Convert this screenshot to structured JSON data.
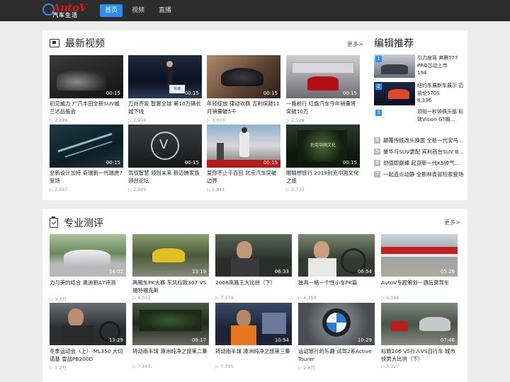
{
  "logo": {
    "text": "AutoV",
    "sub": "汽车生活"
  },
  "nav": [
    "首页",
    "视频",
    "直播"
  ],
  "latest": {
    "title": "最新视频",
    "more": "更多>",
    "items": [
      {
        "title": "初见威力 广汽丰田全新SUV威兰达品鉴会",
        "views": "▷ 2,886",
        "dur": "00:15"
      },
      {
        "title": "万尚齐发 智惠全球 第10万辆长城下线",
        "views": "▷ 2,946",
        "dur": "00:15"
      },
      {
        "title": "年轻绽放 律动欢跳 吉利缤越11月销量破5千",
        "views": "▷ 3,003",
        "dur": "00:15"
      },
      {
        "title": "一路前行 红旗汽车今年销量将突破10万",
        "views": "▷ 2,529",
        "dur": "00:15"
      },
      {
        "title": "全新设计加持 奇瑞新一代瑞虎7登场",
        "views": "▷ 2,947",
        "dur": "00:15"
      },
      {
        "title": "驾驭智慧 领创未来 新迈腾家族领创论坛",
        "views": "▷ 2,909",
        "dur": "00:15"
      },
      {
        "title": "爱你不止千百回 北京汽车突破边界",
        "views": "▷ 2,811",
        "dur": "00:15"
      },
      {
        "title": "眼睛想旅行 2019别克中国文化之旅",
        "views": "▷ 2,733",
        "dur": "00:15"
      }
    ]
  },
  "editor": {
    "title": "编辑推荐",
    "featured": [
      {
        "num": "1",
        "text": "引力座驾 奔腾T77 PRO芯动上市",
        "views": "194"
      },
      {
        "num": "2",
        "text": "纽约车展新车展示 迈凯伦570S",
        "views": "6,336"
      },
      {
        "num": "3",
        "text": "领衔一秒钟俱乐部 标致Vision GT概…",
        "views": ""
      }
    ],
    "ranked": [
      {
        "num": "4",
        "text": "颠覆传统改头换面 全新一代宝马…"
      },
      {
        "num": "5",
        "text": "豪华与SUV更配 宾利首台SUV B…"
      },
      {
        "num": "6",
        "text": "劲值即巅峰 起亚新一代K5帅气…"
      },
      {
        "num": "7",
        "text": "一起造点动静 全新林肯冒险家登场"
      }
    ]
  },
  "review": {
    "title": "专业测评",
    "more": "更多>",
    "items": [
      {
        "title": "力与美的结合 奥迪新A7评测",
        "views": "▷ 3.3万",
        "dur": "14:01"
      },
      {
        "title": "两厢车PK大赛 东风标致307 VS 福特福克斯",
        "views": "▷ 8,032",
        "dur": "13:19"
      },
      {
        "title": "2008高路王大比拼（下）",
        "views": "▷ 7,174",
        "dur": "06:33"
      },
      {
        "title": "独具一格一个性小车PK篇",
        "views": "▷ 4,190",
        "dur": "06:54"
      },
      {
        "title": "AutoV专题策划—酒后莫驾车",
        "views": "▷ 6,146",
        "dur": "05:26"
      },
      {
        "title": "冬季运动会（上）-ML350 大切诺基 雪战PB200D",
        "views": "▷ 1.2万",
        "dur": "13:29"
      },
      {
        "title": "转动南半球 澳洲纯净之旅第二集",
        "views": "▷ 7,167",
        "dur": "09:17"
      },
      {
        "title": "转动南半球 澳洲纯净之旅第三集",
        "views": "▷ 7,705",
        "dur": "10:54"
      },
      {
        "title": "运动旅行的乐趣 试驾2系Active Tourer",
        "views": "▷ 2.8万",
        "dur": "10:29"
      },
      {
        "title": "标致206 VS行人VS自行车 城市快男大比拼（下）",
        "views": "▷ 5,227",
        "dur": "07:46"
      }
    ]
  },
  "colors": {
    "accent": "#2b8ef0",
    "nav_bg": "#2c2c2c",
    "page_bg": "#ececec",
    "logo_red": "#d91c1c"
  }
}
